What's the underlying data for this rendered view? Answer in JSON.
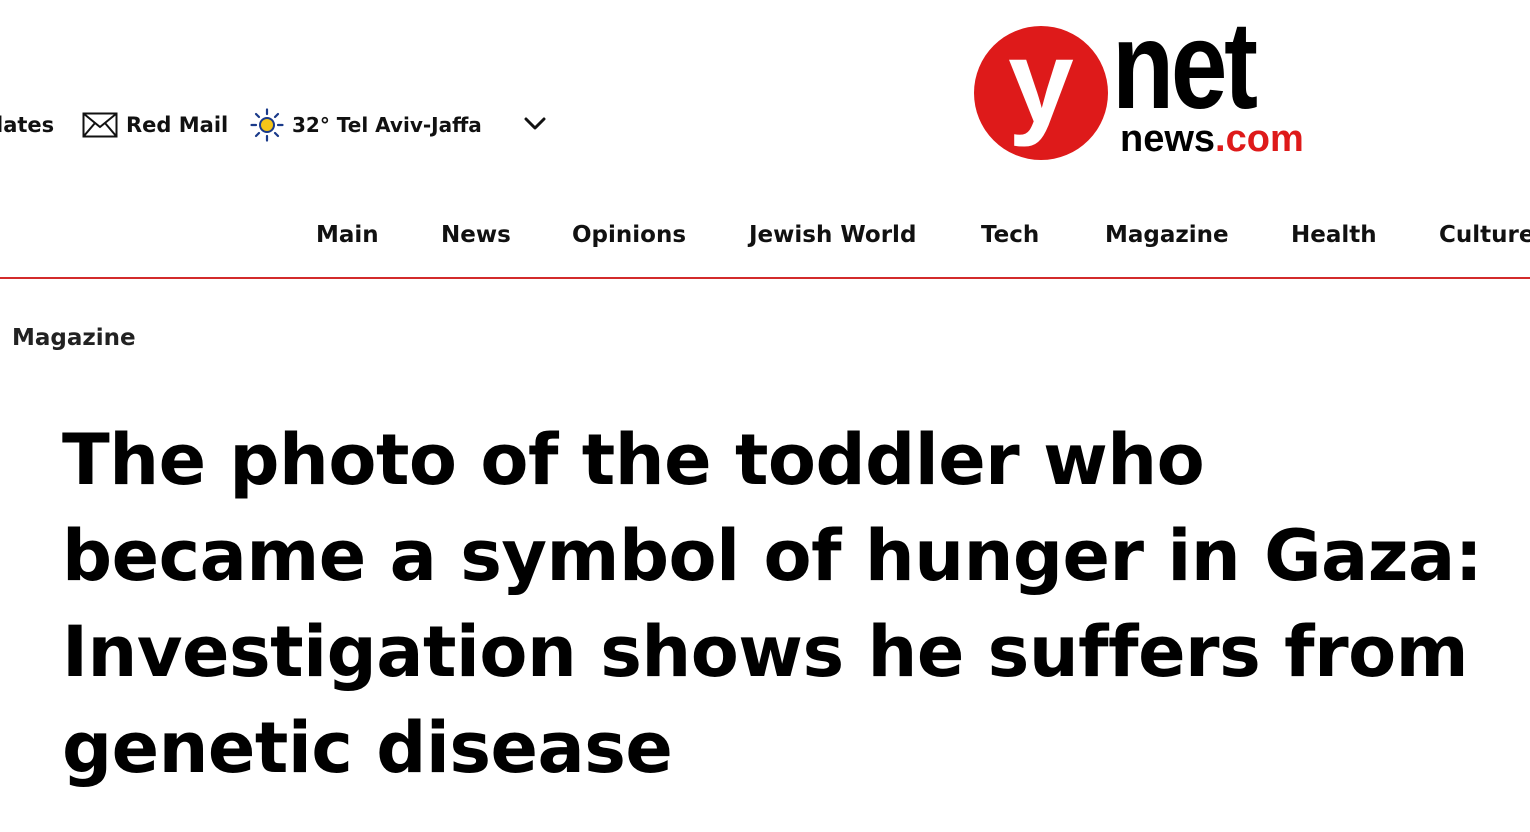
{
  "utility_bar": {
    "updates_label": "lates",
    "mail_label": "Red Mail",
    "weather_label": "32° Tel Aviv-Jaffa",
    "mail_icon": "envelope-icon",
    "weather_icon": "sun-icon",
    "dropdown_icon": "chevron-down-icon"
  },
  "logo": {
    "y": "y",
    "net": "net",
    "news": "news",
    "dotcom": ".com",
    "brand_red": "#de1a1a"
  },
  "nav": {
    "items": [
      {
        "label": "Main"
      },
      {
        "label": "News"
      },
      {
        "label": "Opinions"
      },
      {
        "label": "Jewish World"
      },
      {
        "label": "Tech"
      },
      {
        "label": "Magazine"
      },
      {
        "label": "Health"
      },
      {
        "label": "Culture"
      }
    ],
    "rule_color": "#d32b2b"
  },
  "article": {
    "section": "Magazine",
    "headline": "The photo of the toddler who became a symbol of hunger in Gaza: Investigation shows he suffers from genetic disease"
  }
}
